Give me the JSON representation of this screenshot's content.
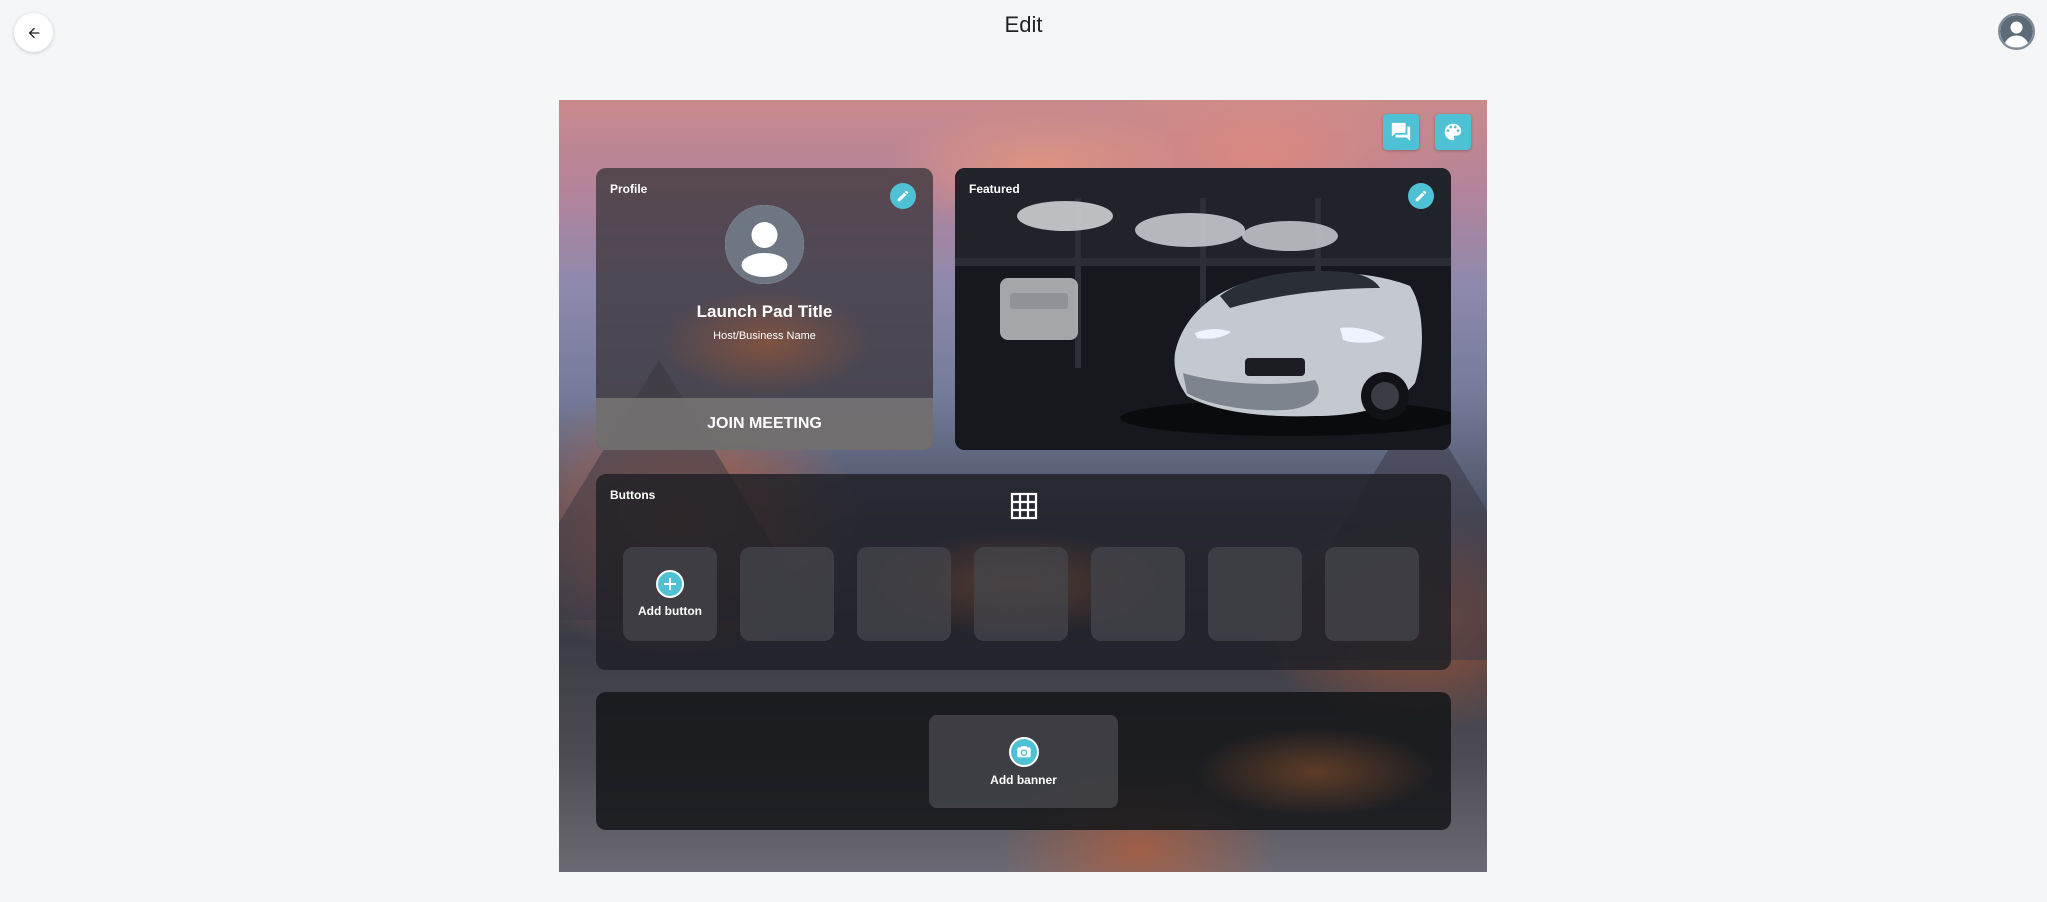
{
  "header": {
    "title": "Edit",
    "back_icon": "arrow-left-icon",
    "account_icon": "account-circle-icon"
  },
  "toolbar": {
    "chat_icon": "chat-icon",
    "theme_icon": "palette-icon"
  },
  "profile": {
    "label": "Profile",
    "title": "Launch Pad Title",
    "subtitle": "Host/Business Name",
    "join_label": "JOIN MEETING"
  },
  "featured": {
    "label": "Featured"
  },
  "buttons": {
    "label": "Buttons",
    "add_label": "Add button"
  },
  "banner": {
    "add_label": "Add banner"
  },
  "colors": {
    "accent": "#4ec2d4",
    "page_bg": "#f4f6f8"
  }
}
